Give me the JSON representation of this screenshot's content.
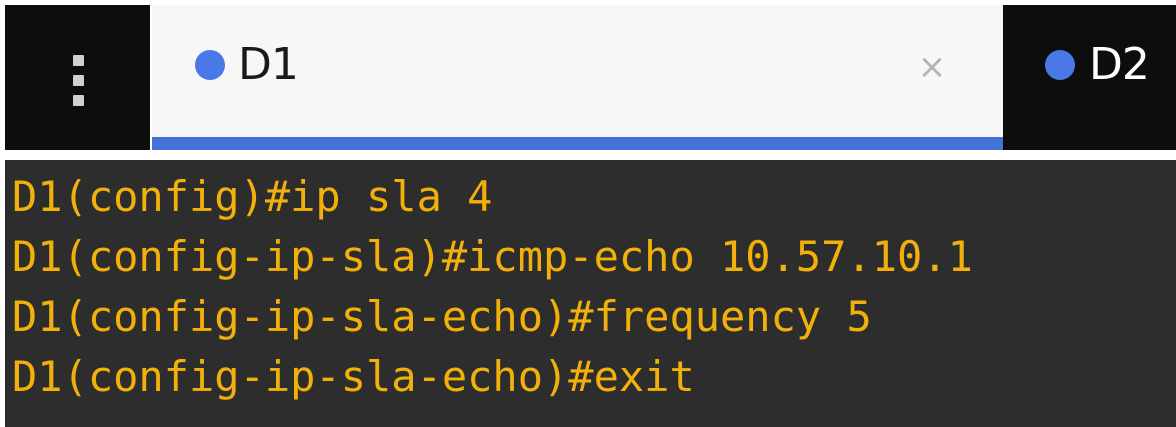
{
  "menu": {
    "icon": "kebab-menu-icon"
  },
  "tabs": [
    {
      "label": "D1",
      "active": true,
      "dot_color": "#4a78e6",
      "close_glyph": "×"
    },
    {
      "label": "D2",
      "active": false,
      "dot_color": "#4a78e6"
    }
  ],
  "colors": {
    "active_tab_underline": "#4472d9",
    "tab_bar_bg": "#0d0d0d",
    "terminal_bg": "#2d2d2d",
    "terminal_text": "#f2b10a"
  },
  "terminal": {
    "lines": [
      "D1(config)#ip sla 4",
      "D1(config-ip-sla)#icmp-echo 10.57.10.1",
      "D1(config-ip-sla-echo)#frequency 5",
      "D1(config-ip-sla-echo)#exit"
    ]
  }
}
